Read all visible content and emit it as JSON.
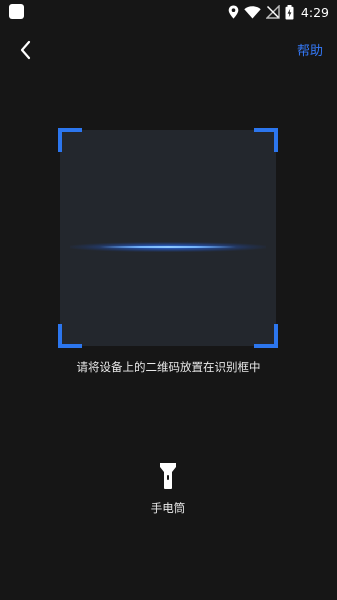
{
  "status_bar": {
    "time": "4:29",
    "icons": [
      "location-icon",
      "wifi-icon",
      "no-signal-icon",
      "battery-icon"
    ]
  },
  "header": {
    "back_icon": "chevron-left-icon",
    "help_label": "帮助"
  },
  "scanner": {
    "hint": "请将设备上的二维码放置在识别框中",
    "accent_color": "#2c76ee"
  },
  "flashlight": {
    "icon": "flashlight-icon",
    "label": "手电筒"
  },
  "colors": {
    "background": "#161616",
    "scan_area": "#23272d",
    "link": "#3478f6"
  }
}
